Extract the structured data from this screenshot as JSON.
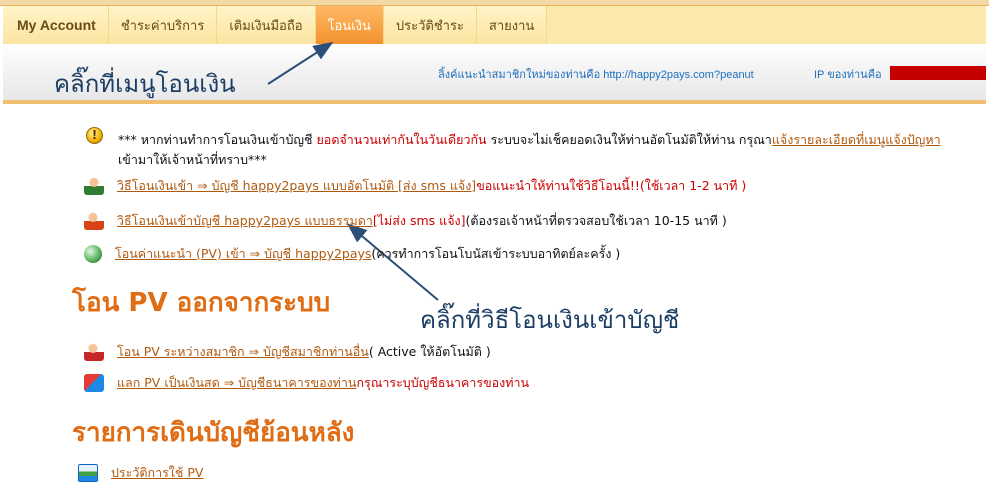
{
  "nav": {
    "items": [
      {
        "label": "My Account"
      },
      {
        "label": "ชำระค่าบริการ"
      },
      {
        "label": "เติมเงินมือถือ"
      },
      {
        "label": "โอนเงิน"
      },
      {
        "label": "ประวัติชำระ"
      },
      {
        "label": "สายงาน"
      }
    ],
    "active_index": 3
  },
  "info": {
    "referral": "ลิ้งค์แนะนำสมาชิกใหม่ของท่านคือ http://happy2pays.com?peanut",
    "ip_label": "IP ของท่านคือ"
  },
  "callouts": {
    "menu": "คลิ๊กที่เมนูโอนเงิน",
    "method": "คลิ๊กที่วิธีโอนเงินเข้าบัญชี"
  },
  "notice": {
    "part1": "*** หากท่านทำการโอนเงินเข้าบัญชี ",
    "part2_red": "ยอดจำนวนเท่ากันในวันเดียวกัน",
    "part3": " ระบบจะไม่เช็คยอดเงินให้ท่านอัตโนมัติให้ท่าน กรุณา",
    "link": "แจ้งรายละเอียดที่เมนูแจ้งปัญหา",
    "part4": "เข้ามาให้เจ้าหน้าที่ทราบ***"
  },
  "transfer_in": [
    {
      "link": "วิธีโอนเงินเข้า ⇒ บัญชี happy2pays แบบอัตโนมัติ [ส่ง sms แจ้ง]",
      "note": " ขอแนะนำให้ท่านใช้วิธีโอนนี้!!(ใช้เวลา 1-2 นาที )",
      "note_color": "red"
    },
    {
      "link": "วิธีโอนเงินเข้าบัญชี happy2pays แบบธรรมดา",
      "note_red": " [ไม่ส่ง sms แจ้ง]",
      "note": " (ต้องรอเจ้าหน้าที่ตรวจสอบใช้เวลา 10-15 นาที )"
    },
    {
      "link": "โอนค่าแนะนำ (PV) เข้า ⇒ บัญชี happy2pays",
      "note": " (ควรทำการโอนโบนัสเข้าระบบอาทิตย์ละครั้ง )"
    }
  ],
  "sections": {
    "pv_out": "โอน PV ออกจากระบบ",
    "history": "รายการเดินบัญชีย้อนหลัง"
  },
  "pv_out": [
    {
      "link": "โอน PV ระหว่างสมาชิก ⇒ บัญชีสมาชิกท่านอื่น",
      "note": " ( Active ให้อัตโนมัติ )"
    },
    {
      "link": "แลก PV เป็นเงินสด ⇒ บัญชีธนาคารของท่าน",
      "note_red": " กรุณาระบุบัญชีธนาคารของท่าน"
    }
  ],
  "history": {
    "link": "ประวัติการใช้ PV"
  },
  "colors": {
    "accent": "#f3922f",
    "section_title": "#e06d14",
    "link": "#b05a10",
    "alert": "#cc0000",
    "callout": "#1c3e66"
  }
}
